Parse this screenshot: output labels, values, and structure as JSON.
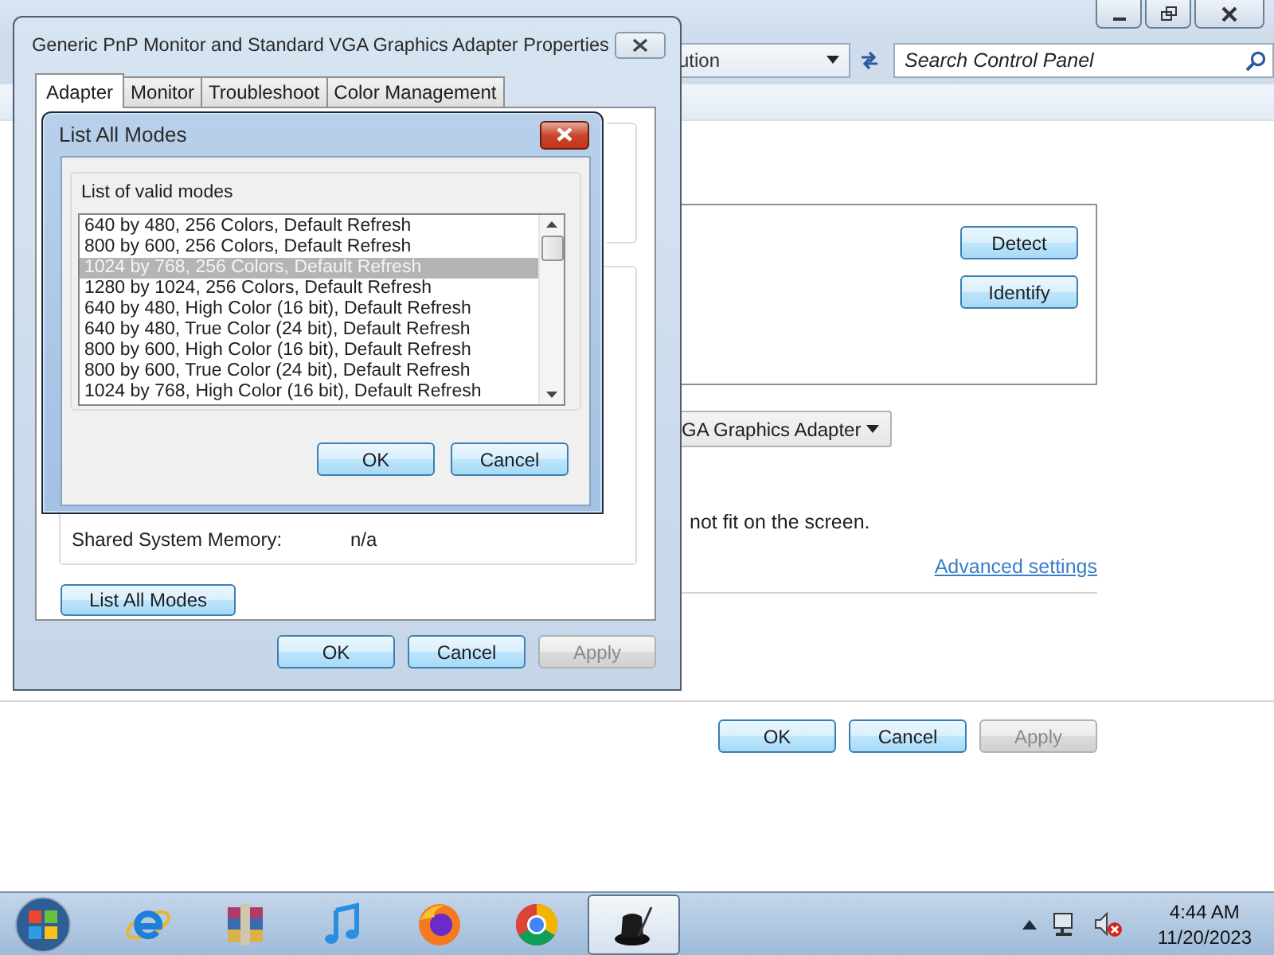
{
  "main_window": {
    "address": "ution",
    "search": {
      "placeholder": "Search Control Panel"
    },
    "side_buttons": [
      {
        "label": "Detect"
      },
      {
        "label": "Identify"
      }
    ],
    "adapter_dropdown": "GA Graphics Adapter",
    "note": "not fit on the screen.",
    "link": "Advanced settings",
    "buttons": [
      {
        "label": "OK",
        "disabled": false
      },
      {
        "label": "Cancel",
        "disabled": false
      },
      {
        "label": "Apply",
        "disabled": true
      }
    ]
  },
  "properties_dialog": {
    "title": "Generic PnP Monitor and Standard VGA Graphics Adapter Properties",
    "tabs": [
      {
        "label": "Adapter",
        "selected": true
      },
      {
        "label": "Monitor",
        "selected": false
      },
      {
        "label": "Troubleshoot",
        "selected": false
      },
      {
        "label": "Color Management",
        "selected": false
      }
    ],
    "memory_label": "Shared System Memory:",
    "memory_value": "n/a",
    "list_modes_button": "List All Modes",
    "buttons": [
      {
        "label": "OK",
        "disabled": false
      },
      {
        "label": "Cancel",
        "disabled": false
      },
      {
        "label": "Apply",
        "disabled": true
      }
    ]
  },
  "modes_dialog": {
    "title": "List All Modes",
    "group_label": "List of valid modes",
    "modes": [
      {
        "text": "640 by 480, 256 Colors, Default Refresh",
        "selected": false
      },
      {
        "text": "800 by 600, 256 Colors, Default Refresh",
        "selected": false
      },
      {
        "text": "1024 by 768, 256 Colors, Default Refresh",
        "selected": true
      },
      {
        "text": "1280 by 1024, 256 Colors, Default Refresh",
        "selected": false
      },
      {
        "text": "640 by 480, High Color (16 bit), Default Refresh",
        "selected": false
      },
      {
        "text": "640 by 480, True Color (24 bit), Default Refresh",
        "selected": false
      },
      {
        "text": "800 by 600, High Color (16 bit), Default Refresh",
        "selected": false
      },
      {
        "text": "800 by 600, True Color (24 bit), Default Refresh",
        "selected": false
      },
      {
        "text": "1024 by 768, High Color (16 bit), Default Refresh",
        "selected": false
      }
    ],
    "buttons": [
      {
        "label": "OK",
        "disabled": false
      },
      {
        "label": "Cancel",
        "disabled": false
      }
    ]
  },
  "taskbar": {
    "apps": [
      {
        "selected": false
      },
      {
        "selected": false
      },
      {
        "selected": false
      },
      {
        "selected": false
      },
      {
        "selected": false
      },
      {
        "selected": true
      }
    ],
    "time": "4:44 AM",
    "date": "11/20/2023"
  }
}
